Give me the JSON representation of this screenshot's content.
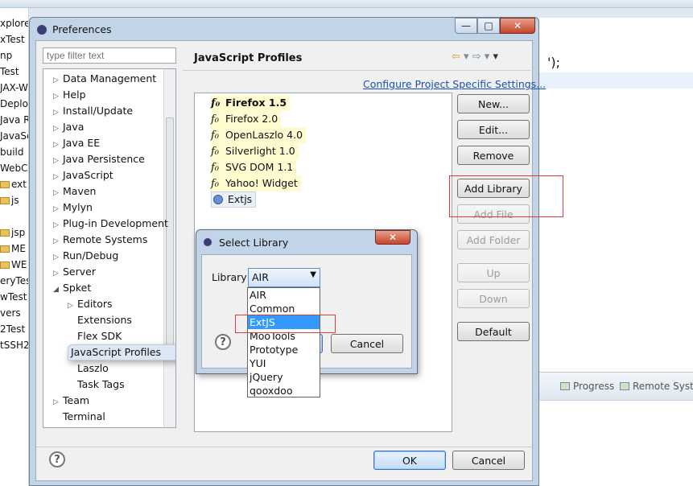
{
  "workspace": {
    "project_tree": [
      "xplore",
      "xTest",
      "np",
      "Test",
      "JAX-W",
      "Deplo",
      "Java R",
      "JavaSc",
      "build",
      "WebC",
      "ext",
      "js",
      "",
      "jsp",
      "ME",
      "WE",
      "eryTest",
      "wTest",
      "vers",
      "2Test",
      "tSSH2"
    ],
    "editor_code": "');",
    "bottom_tabs": [
      "Progress",
      "Remote Syste"
    ]
  },
  "preferences": {
    "title": "Preferences",
    "window_buttons": [
      "—",
      "□",
      "✕"
    ],
    "filter_placeholder": "type filter text",
    "tree": [
      {
        "label": "Data Management",
        "level": 0,
        "arrow": "▷"
      },
      {
        "label": "Help",
        "level": 0,
        "arrow": "▷"
      },
      {
        "label": "Install/Update",
        "level": 0,
        "arrow": "▷"
      },
      {
        "label": "Java",
        "level": 0,
        "arrow": "▷"
      },
      {
        "label": "Java EE",
        "level": 0,
        "arrow": "▷"
      },
      {
        "label": "Java Persistence",
        "level": 0,
        "arrow": "▷"
      },
      {
        "label": "JavaScript",
        "level": 0,
        "arrow": "▷"
      },
      {
        "label": "Maven",
        "level": 0,
        "arrow": "▷"
      },
      {
        "label": "Mylyn",
        "level": 0,
        "arrow": "▷"
      },
      {
        "label": "Plug-in Development",
        "level": 0,
        "arrow": "▷"
      },
      {
        "label": "Remote Systems",
        "level": 0,
        "arrow": "▷"
      },
      {
        "label": "Run/Debug",
        "level": 0,
        "arrow": "▷"
      },
      {
        "label": "Server",
        "level": 0,
        "arrow": "▷"
      },
      {
        "label": "Spket",
        "level": 0,
        "arrow": "◢"
      },
      {
        "label": "Editors",
        "level": 1,
        "arrow": "▷"
      },
      {
        "label": "Extensions",
        "level": 1,
        "arrow": ""
      },
      {
        "label": "Flex SDK",
        "level": 1,
        "arrow": ""
      },
      {
        "label": "JavaScript Profiles",
        "level": 1,
        "arrow": "",
        "selected": true
      },
      {
        "label": "Laszlo",
        "level": 1,
        "arrow": ""
      },
      {
        "label": "Task Tags",
        "level": 1,
        "arrow": ""
      },
      {
        "label": "Team",
        "level": 0,
        "arrow": "▷"
      },
      {
        "label": "Terminal",
        "level": 0,
        "arrow": ""
      }
    ],
    "page_title": "JavaScript Profiles",
    "nav_back": "⇦",
    "nav_forward": "⇨",
    "nav_menu": "▾",
    "configure_link": "Configure Project Specific Settings...",
    "profiles": [
      {
        "icon": "f₀",
        "name": "Firefox 1.5",
        "bold": true
      },
      {
        "icon": "f₀",
        "name": "Firefox 2.0"
      },
      {
        "icon": "f₀",
        "name": "OpenLaszlo 4.0"
      },
      {
        "icon": "f₀",
        "name": "Silverlight 1.0"
      },
      {
        "icon": "f₀",
        "name": "SVG DOM 1.1"
      },
      {
        "icon": "f₀",
        "name": "Yahoo! Widget"
      },
      {
        "icon": "",
        "name": "Extjs",
        "library": true
      }
    ],
    "buttons": {
      "new": "New...",
      "edit": "Edit...",
      "remove": "Remove",
      "add_library": "Add Library",
      "add_file": "Add File",
      "add_folder": "Add Folder",
      "up": "Up",
      "down": "Down",
      "default": "Default",
      "ok": "OK",
      "cancel": "Cancel"
    },
    "help_glyph": "?"
  },
  "select_library": {
    "title": "Select Library",
    "close": "✕",
    "label": "Library",
    "selected": "AIR",
    "options": [
      "AIR",
      "Common",
      "ExtJS",
      "MooTools",
      "Prototype",
      "YUI",
      "jQuery",
      "qooxdoo"
    ],
    "highlighted": "ExtJS",
    "cancel": "Cancel",
    "help_glyph": "?"
  },
  "colors": {
    "accent_blue": "#3399ff",
    "annotation_red": "#e03a3a",
    "link": "#1a4fb0",
    "title_frame": "#c2d4e8"
  }
}
